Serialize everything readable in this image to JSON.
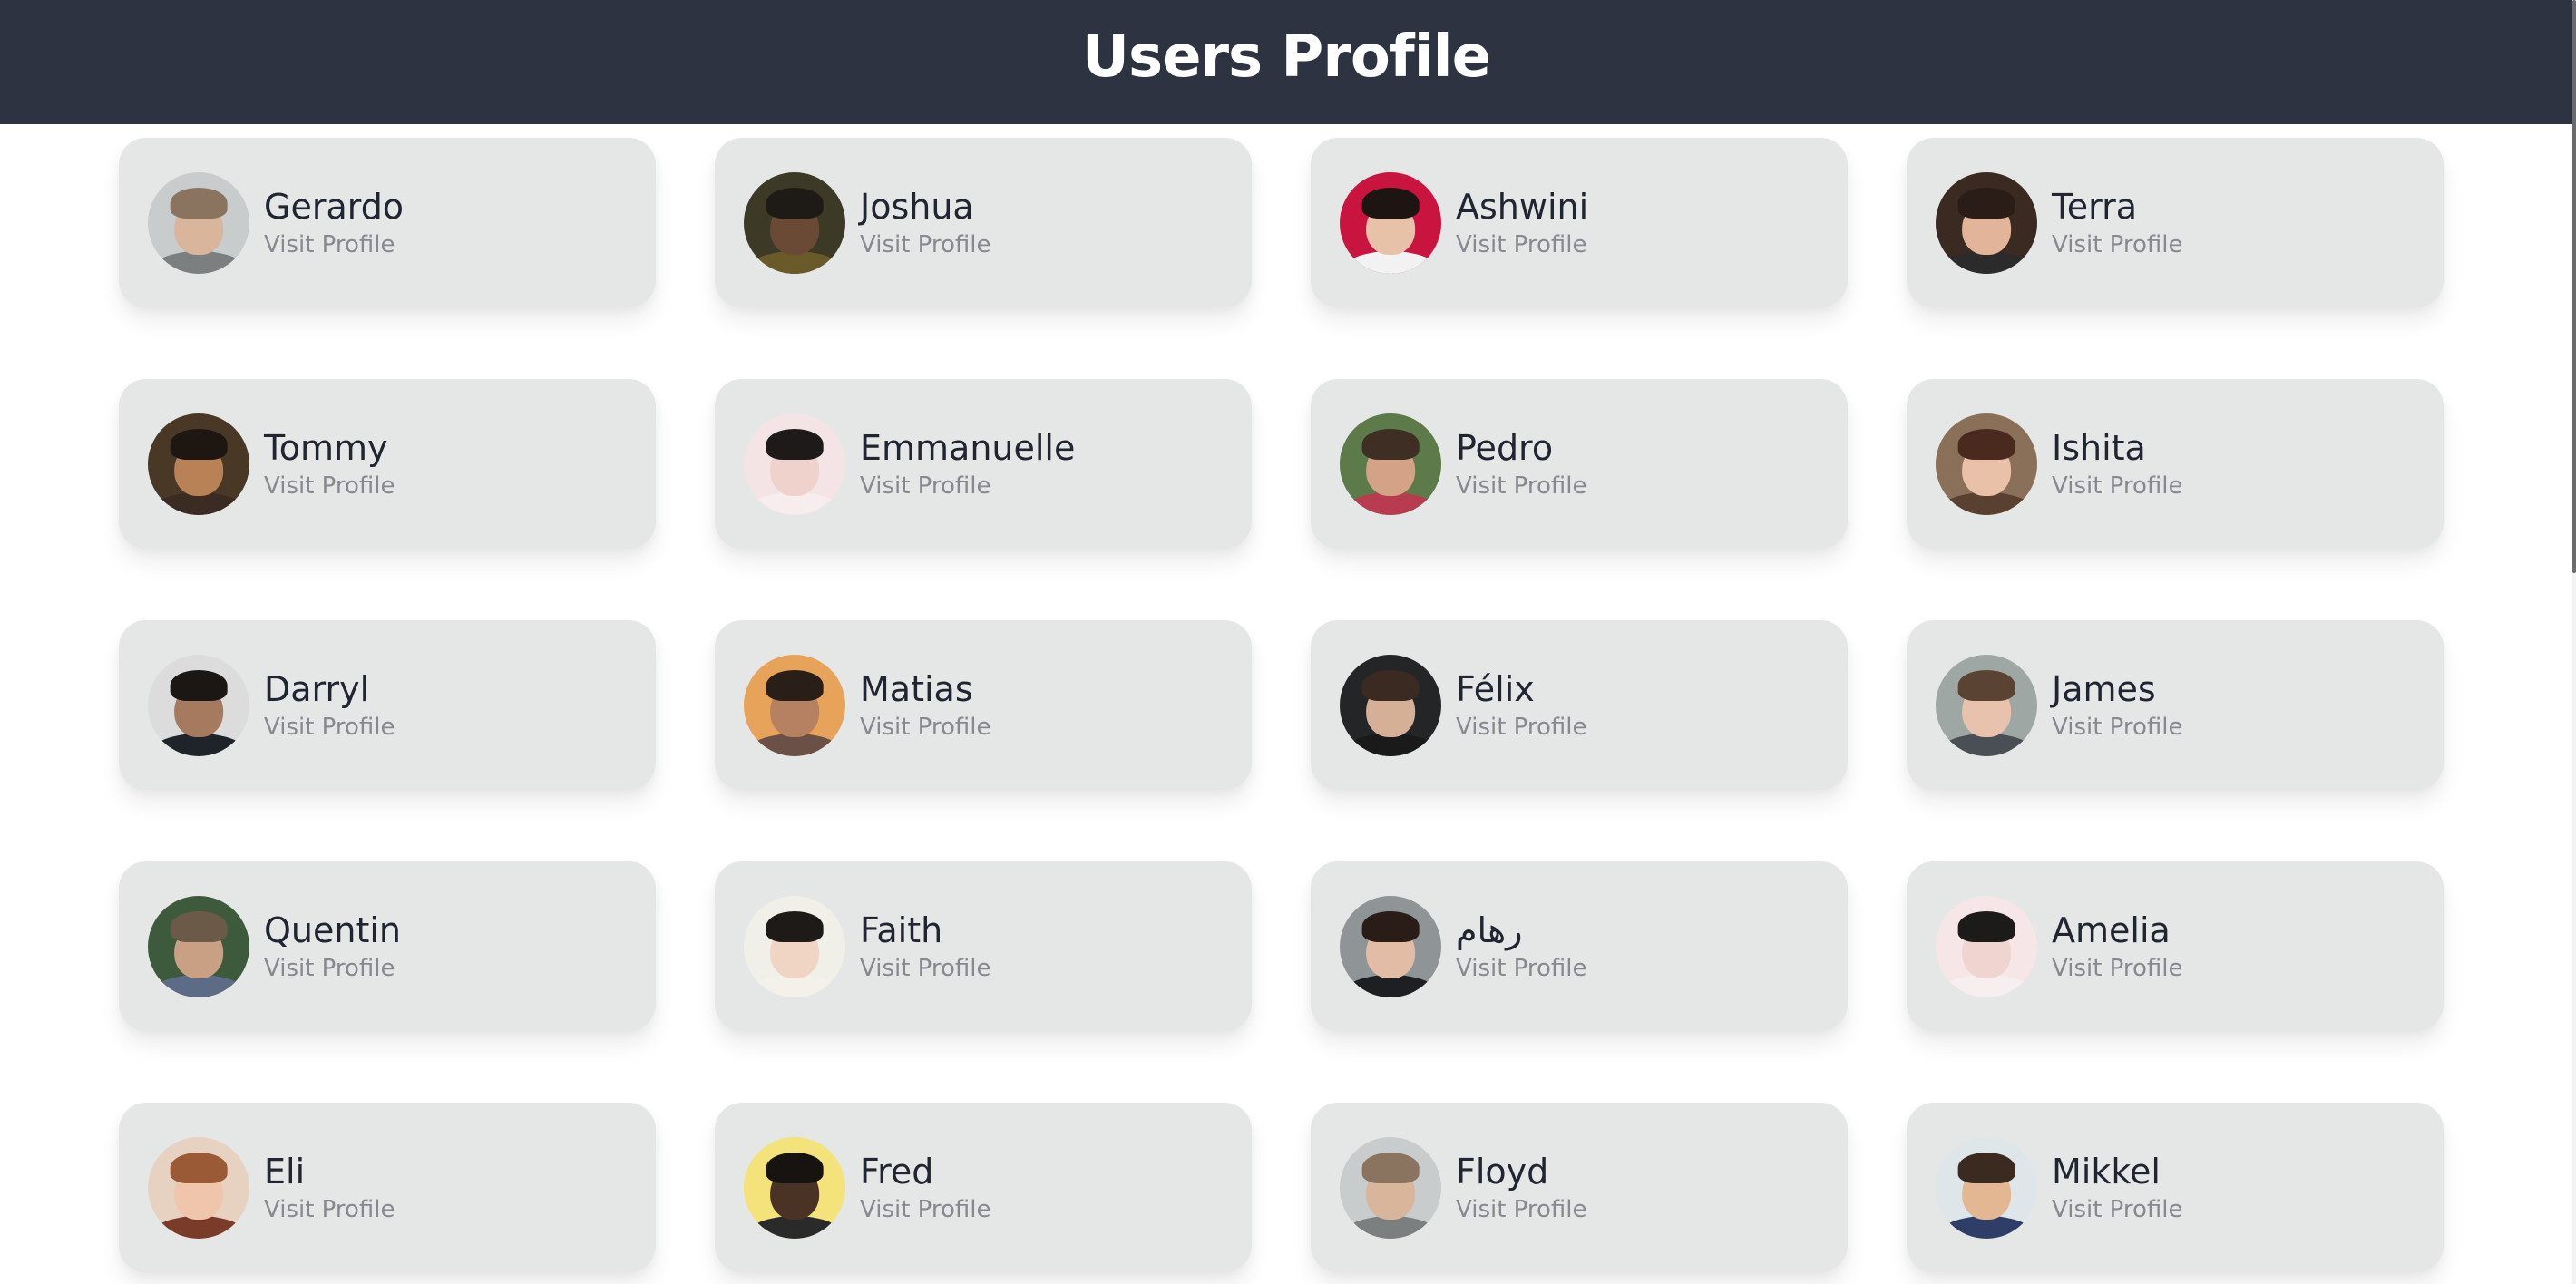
{
  "header": {
    "title": "Users Profile"
  },
  "users": [
    {
      "name": "Gerardo",
      "link": "Visit Profile",
      "bg": "#c9cccd",
      "skin": "#d9b59c",
      "hair": "#8a7460",
      "shirt": "#7b7f80"
    },
    {
      "name": "Joshua",
      "link": "Visit Profile",
      "bg": "#3c3a26",
      "skin": "#6a4a35",
      "hair": "#1e1b16",
      "shirt": "#6a5a2a"
    },
    {
      "name": "Ashwini",
      "link": "Visit Profile",
      "bg": "#c8143e",
      "skin": "#e7c2a9",
      "hair": "#1c1512",
      "shirt": "#f2f2f2"
    },
    {
      "name": "Terra",
      "link": "Visit Profile",
      "bg": "#3a2a22",
      "skin": "#e2b49a",
      "hair": "#2a1c16",
      "shirt": "#2b2b2b"
    },
    {
      "name": "Tommy",
      "link": "Visit Profile",
      "bg": "#4a3826",
      "skin": "#b98156",
      "hair": "#1d1611",
      "shirt": "#3a2c22"
    },
    {
      "name": "Emmanuelle",
      "link": "Visit Profile",
      "bg": "#f5e4e6",
      "skin": "#f0d2cc",
      "hair": "#1e1a1a",
      "shirt": "#f7ecee"
    },
    {
      "name": "Pedro",
      "link": "Visit Profile",
      "bg": "#5c7a4a",
      "skin": "#d3a287",
      "hair": "#3e2e24",
      "shirt": "#b93b4f"
    },
    {
      "name": "Ishita",
      "link": "Visit Profile",
      "bg": "#8a7058",
      "skin": "#e9c0a8",
      "hair": "#4a2a1e",
      "shirt": "#5a4030"
    },
    {
      "name": "Darryl",
      "link": "Visit Profile",
      "bg": "#dcdcdc",
      "skin": "#a57a5e",
      "hair": "#1b1715",
      "shirt": "#1f242b"
    },
    {
      "name": "Matias",
      "link": "Visit Profile",
      "bg": "#e8a35a",
      "skin": "#b58160",
      "hair": "#2a1f18",
      "shirt": "#6a5046"
    },
    {
      "name": "Félix",
      "link": "Visit Profile",
      "bg": "#232526",
      "skin": "#d6b096",
      "hair": "#3a2a22",
      "shirt": "#1a1a1a"
    },
    {
      "name": "James",
      "link": "Visit Profile",
      "bg": "#9fa7a4",
      "skin": "#e8c2ad",
      "hair": "#5a4332",
      "shirt": "#4a4e55"
    },
    {
      "name": "Quentin",
      "link": "Visit Profile",
      "bg": "#3e5a3c",
      "skin": "#caa084",
      "hair": "#6b5a48",
      "shirt": "#5d6c86"
    },
    {
      "name": "Faith",
      "link": "Visit Profile",
      "bg": "#f1f0e8",
      "skin": "#f1d5c4",
      "hair": "#1e1a18",
      "shirt": "#f3f1ea"
    },
    {
      "name": "رهام",
      "link": "Visit Profile",
      "bg": "#8f9497",
      "skin": "#e2bca4",
      "hair": "#2a1d18",
      "shirt": "#1e1f22"
    },
    {
      "name": "Amelia",
      "link": "Visit Profile",
      "bg": "#f6e6e8",
      "skin": "#f0d4cf",
      "hair": "#1d1a1a",
      "shirt": "#f7eeef"
    },
    {
      "name": "Eli",
      "link": "Visit Profile",
      "bg": "#e7d2c2",
      "skin": "#efc6ab",
      "hair": "#9a5a36",
      "shirt": "#7a3b28"
    },
    {
      "name": "Fred",
      "link": "Visit Profile",
      "bg": "#f4e27a",
      "skin": "#4a3224",
      "hair": "#171310",
      "shirt": "#2a2a2a"
    },
    {
      "name": "Floyd",
      "link": "Visit Profile",
      "bg": "#c9cccd",
      "skin": "#d9b59c",
      "hair": "#8a7460",
      "shirt": "#7b7f80"
    },
    {
      "name": "Mikkel",
      "link": "Visit Profile",
      "bg": "#dfe6ea",
      "skin": "#e3b792",
      "hair": "#3b2a20",
      "shirt": "#2e3e66"
    }
  ]
}
